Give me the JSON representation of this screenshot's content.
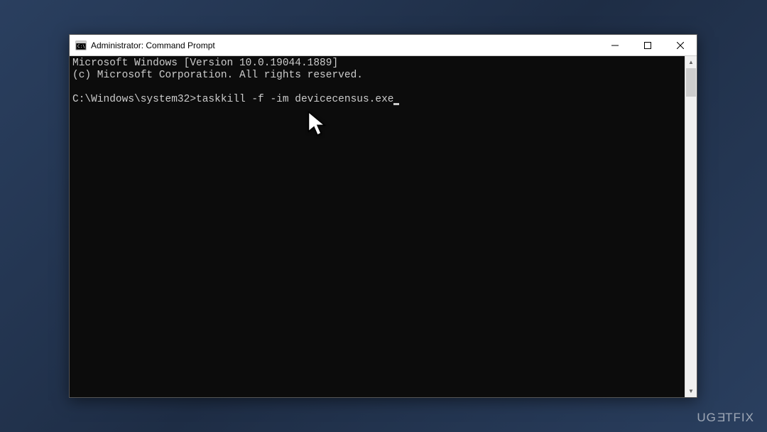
{
  "window": {
    "title": "Administrator: Command Prompt"
  },
  "terminal": {
    "line1": "Microsoft Windows [Version 10.0.19044.1889]",
    "line2": "(c) Microsoft Corporation. All rights reserved.",
    "blank": "",
    "prompt": "C:\\Windows\\system32>",
    "command": "taskkill -f -im devicecensus.exe"
  },
  "watermark": {
    "text_part1": "UG",
    "text_e": "E",
    "text_part2": "TFIX"
  }
}
